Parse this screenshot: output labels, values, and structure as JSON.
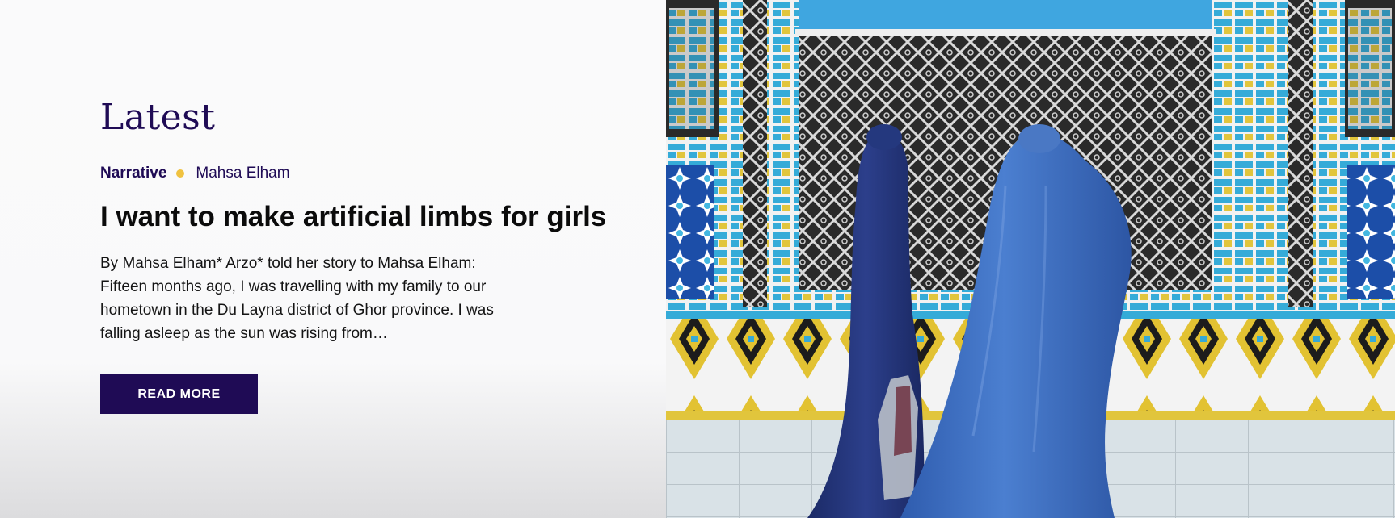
{
  "section": {
    "title": "Latest"
  },
  "article": {
    "category": "Narrative",
    "author": "Mahsa Elham",
    "headline": "I want to make artificial limbs for girls",
    "excerpt": "By Mahsa Elham*  Arzo* told her story to Mahsa Elham: Fifteen months ago, I was travelling with my family to our hometown in the Du Layna district of Ghor province. I was falling asleep as the sun was rising from…",
    "cta_label": "READ MORE"
  },
  "colors": {
    "brand": "#1f0b55",
    "dot": "#f0c240",
    "tile_blue": "#3aaed6",
    "tile_yellow": "#e6c63a",
    "burqa_dark": "#22347a",
    "burqa_light": "#3d6fc4"
  }
}
